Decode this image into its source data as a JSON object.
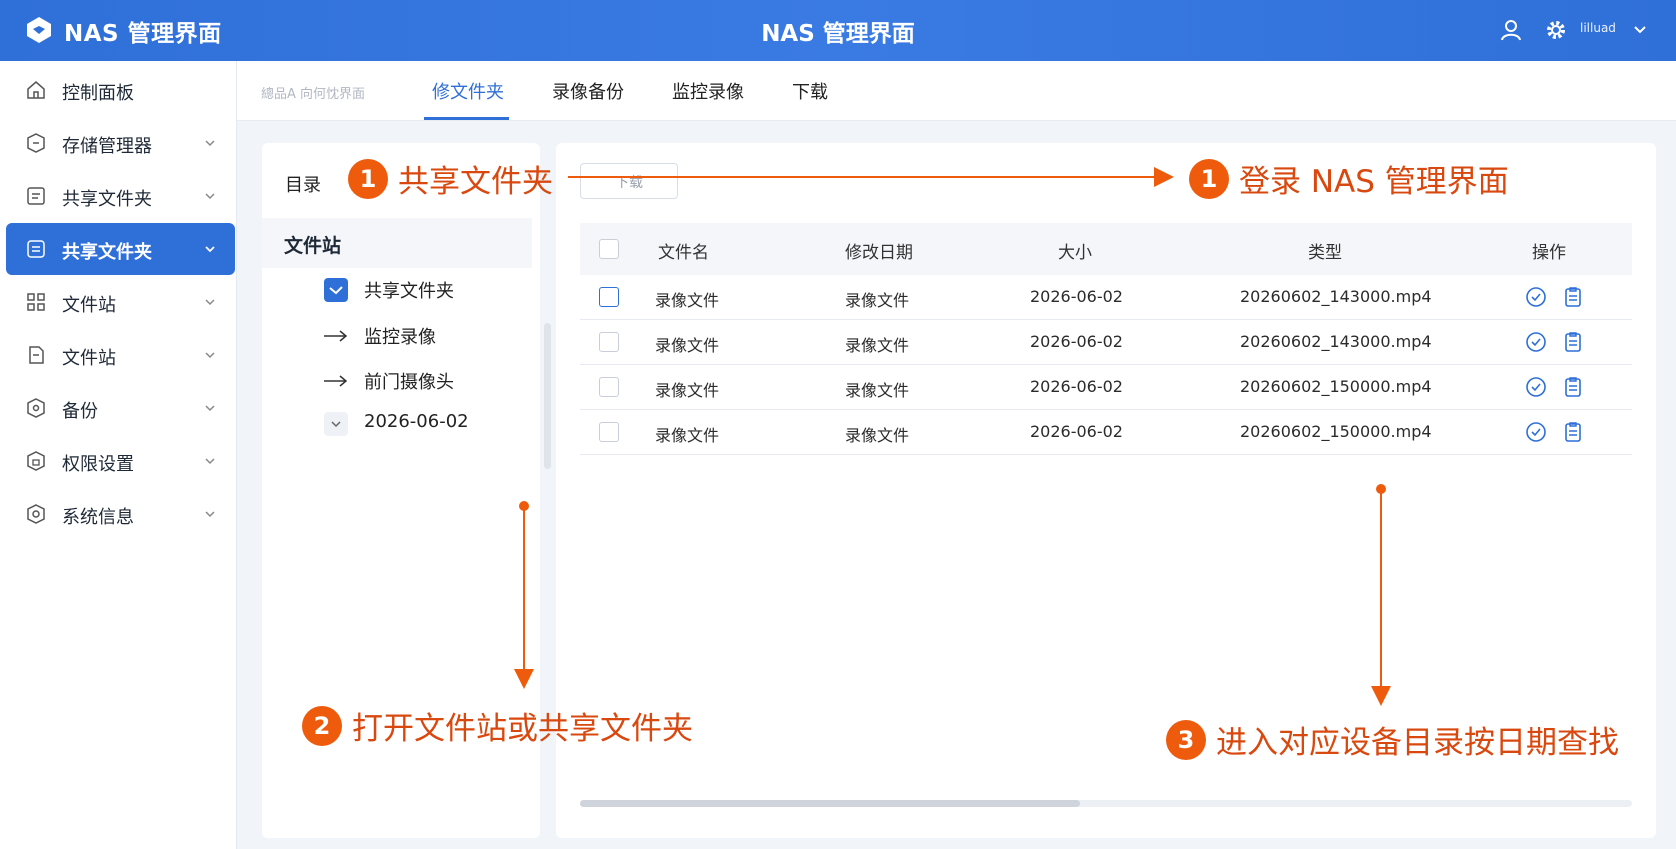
{
  "header": {
    "brand": "NAS 管理界面",
    "center_title": "NAS 管理界面",
    "user_name": "lilluad",
    "icons": [
      "logo-icon",
      "user-icon",
      "gear-icon",
      "chevron-down-icon"
    ]
  },
  "sidebar": {
    "items": [
      {
        "label": "控制面板",
        "icon": "home-icon",
        "chevron": false
      },
      {
        "label": "存储管理器",
        "icon": "storage-icon",
        "chevron": true
      },
      {
        "label": "共享文件夹",
        "icon": "folder-icon",
        "chevron": true
      },
      {
        "label": "共享文件夹",
        "icon": "shared-folder-icon",
        "chevron": true,
        "active": true
      },
      {
        "label": "文件站",
        "icon": "grid-icon",
        "chevron": true
      },
      {
        "label": "文件站",
        "icon": "file-icon",
        "chevron": true
      },
      {
        "label": "备份",
        "icon": "backup-icon",
        "chevron": true
      },
      {
        "label": "权限设置",
        "icon": "permission-icon",
        "chevron": true
      },
      {
        "label": "系统信息",
        "icon": "info-icon",
        "chevron": true
      }
    ]
  },
  "tabs": {
    "crumb": "總品A 向何忱界面",
    "items": [
      "修文件夹",
      "录像备份",
      "监控录像",
      "下载"
    ],
    "active_index": 0
  },
  "directory": {
    "title": "目录",
    "station": "文件站",
    "tree": [
      {
        "label": "共享文件夹",
        "icon": "checkbox-checked-icon"
      },
      {
        "label": "监控录像",
        "icon": "arrow-right-icon"
      },
      {
        "label": "前门摄像头",
        "icon": "arrow-right-icon"
      },
      {
        "label": "2026-06-02",
        "icon": "chevron-down-icon"
      }
    ]
  },
  "main": {
    "download_button": "下载",
    "columns": [
      "文件名",
      "修改日期",
      "大小",
      "类型",
      "操作"
    ],
    "rows": [
      {
        "name": "录像文件",
        "date": "录像文件",
        "size": "2026-06-02",
        "type": "20260602_143000.mp4"
      },
      {
        "name": "录像文件",
        "date": "录像文件",
        "size": "2026-06-02",
        "type": "20260602_143000.mp4"
      },
      {
        "name": "录像文件",
        "date": "录像文件",
        "size": "2026-06-02",
        "type": "20260602_150000.mp4"
      },
      {
        "name": "录像文件",
        "date": "录像文件",
        "size": "2026-06-02",
        "type": "20260602_150000.mp4"
      }
    ]
  },
  "annotations": [
    {
      "num": "1",
      "text": "共享文件夹"
    },
    {
      "num": "1",
      "text": "登录 NAS 管理界面"
    },
    {
      "num": "2",
      "text": "打开文件站或共享文件夹"
    },
    {
      "num": "3",
      "text": "进入对应设备目录按日期查找"
    }
  ],
  "colors": {
    "primary": "#2f6fd8",
    "annotation": "#ef5b0c",
    "annotation_text": "#d9480f"
  }
}
